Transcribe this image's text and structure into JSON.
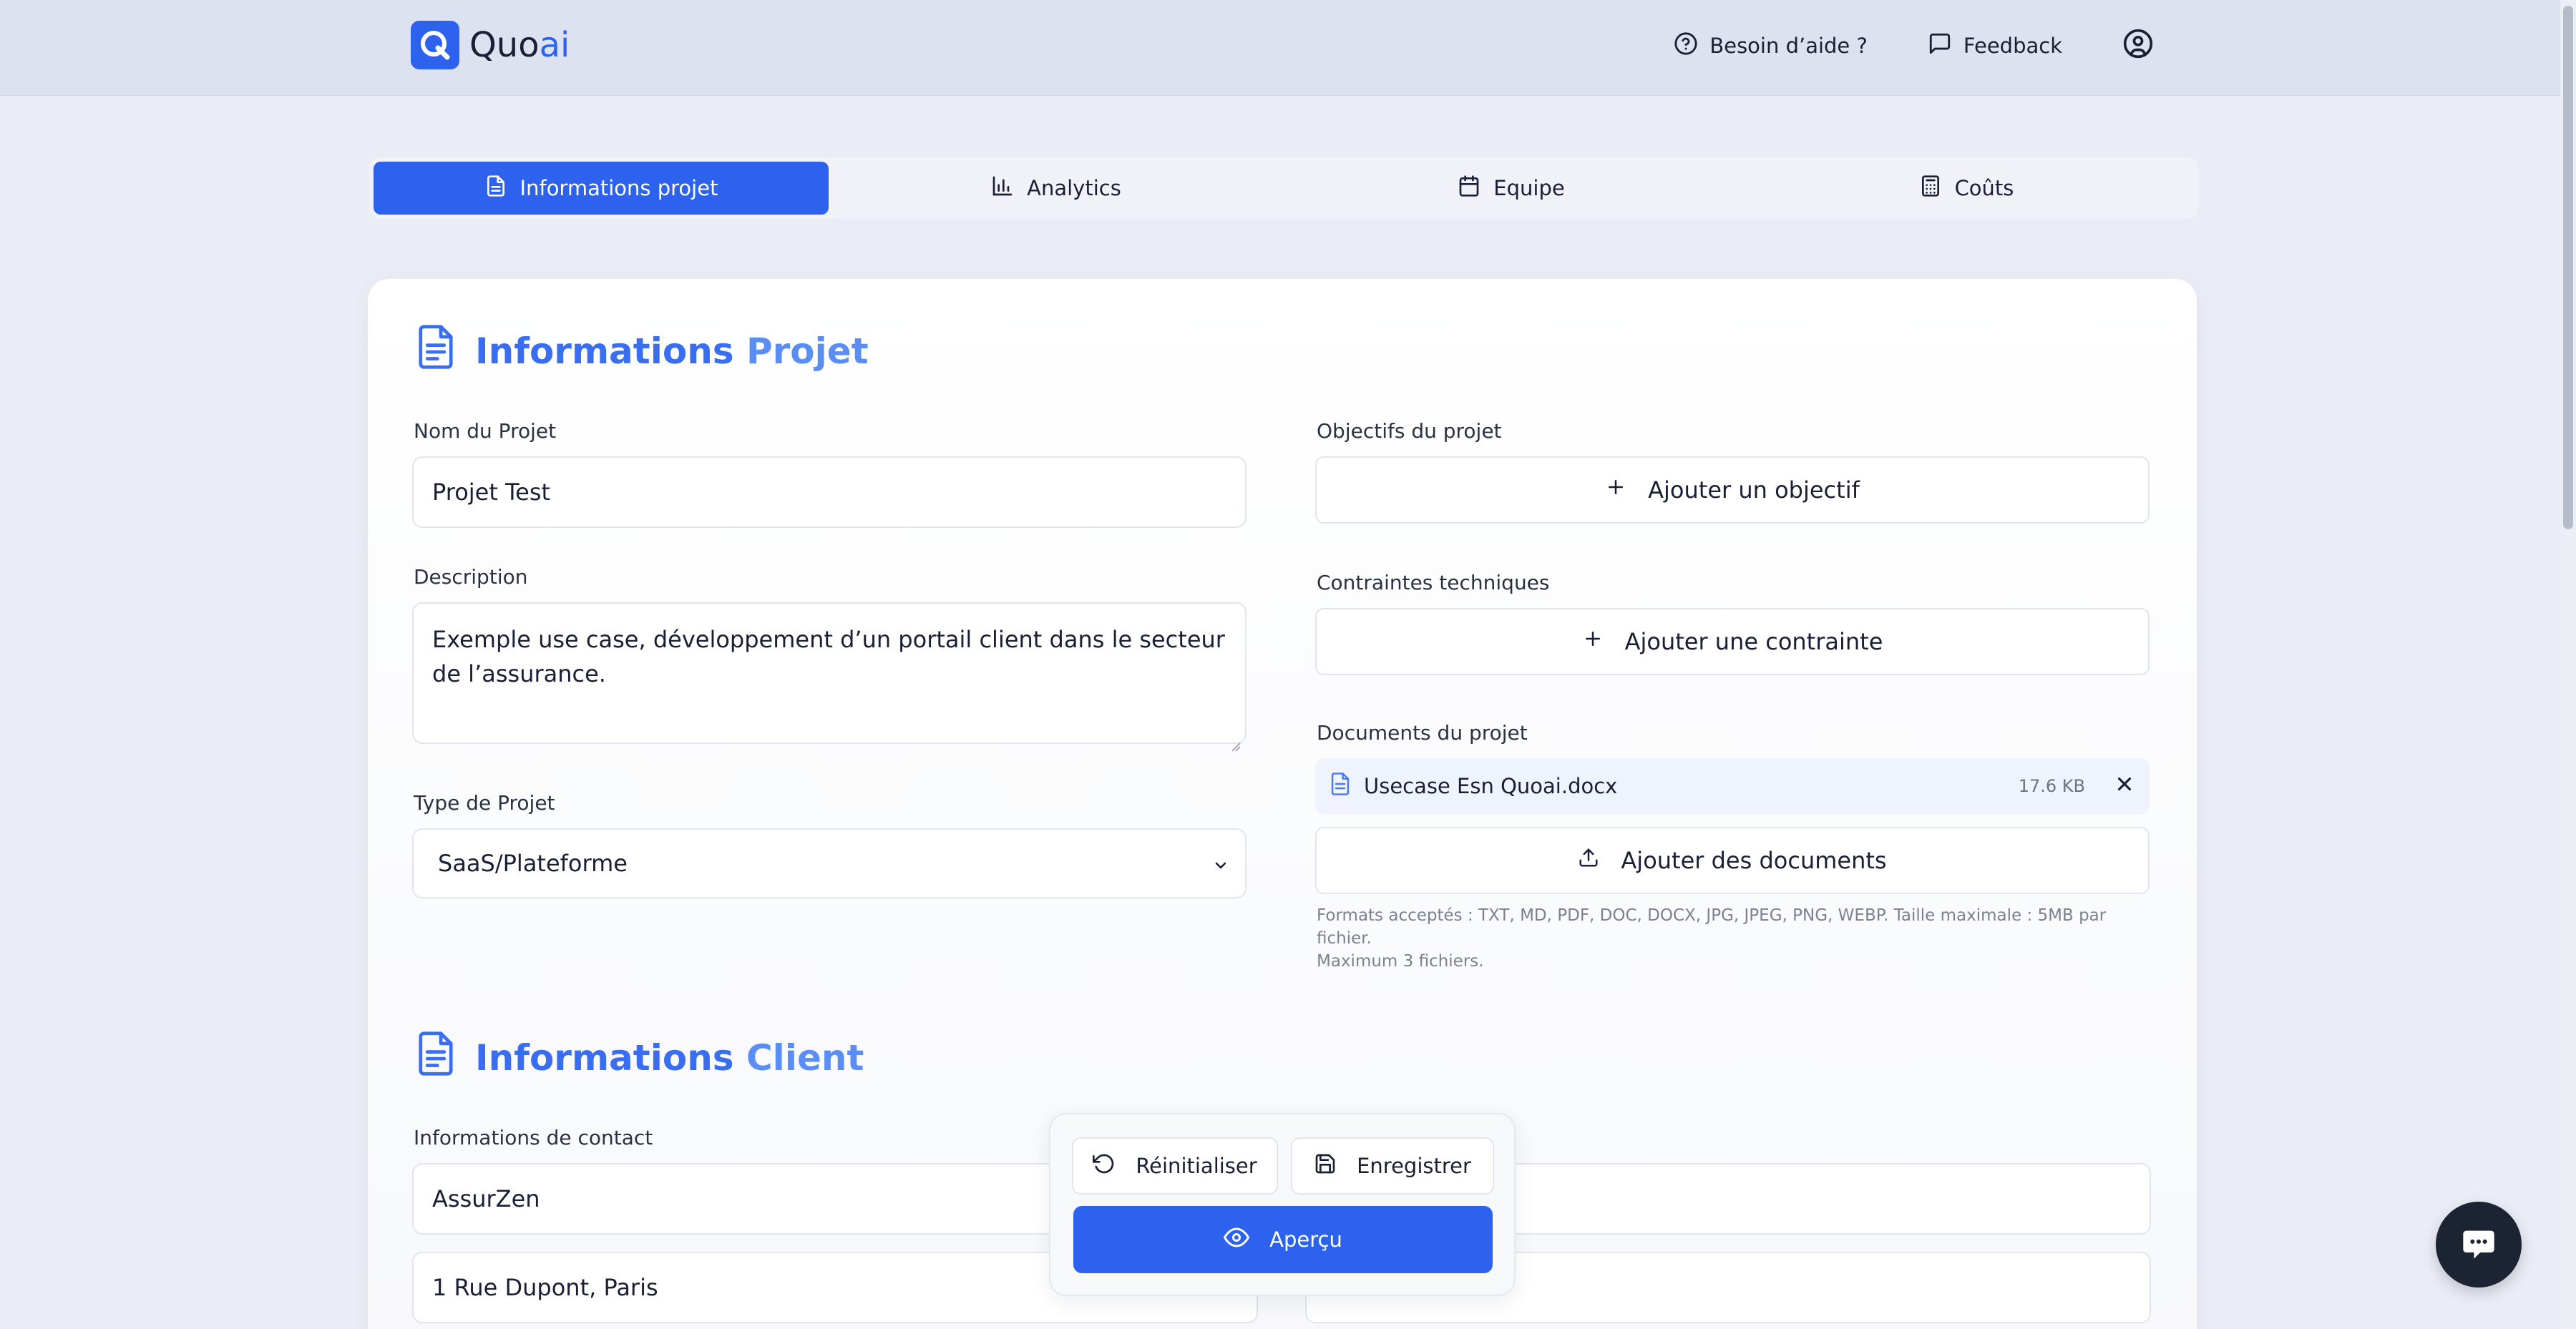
{
  "header": {
    "logo_main": "Quo",
    "logo_accent": "ai",
    "help_label": "Besoin d’aide ?",
    "feedback_label": "Feedback"
  },
  "tabs": [
    {
      "label": "Informations projet",
      "icon": "document-icon",
      "active": true
    },
    {
      "label": "Analytics",
      "icon": "bar-chart-icon",
      "active": false
    },
    {
      "label": "Equipe",
      "icon": "calendar-icon",
      "active": false
    },
    {
      "label": "Coûts",
      "icon": "calculator-icon",
      "active": false
    }
  ],
  "project_section": {
    "title_part1": "Informations",
    "title_part2": "Projet",
    "name_label": "Nom du Projet",
    "name_value": "Projet Test",
    "description_label": "Description",
    "description_value": "Exemple use case, développement d’un portail client dans le secteur de l’assurance.",
    "type_label": "Type de Projet",
    "type_value": "SaaS/Plateforme",
    "objectives_label": "Objectifs du projet",
    "add_objective_label": "Ajouter un objectif",
    "constraints_label": "Contraintes techniques",
    "add_constraint_label": "Ajouter une contrainte",
    "documents_label": "Documents du projet",
    "documents": [
      {
        "name": "Usecase Esn Quoai.docx",
        "size": "17.6 KB"
      }
    ],
    "add_documents_label": "Ajouter des documents",
    "formats_hint_line1": "Formats acceptés : TXT, MD, PDF, DOC, DOCX, JPG, JPEG, PNG, WEBP. Taille maximale : 5MB par fichier.",
    "formats_hint_line2": "Maximum 3 fichiers."
  },
  "client_section": {
    "title_part1": "Informations",
    "title_part2": "Client",
    "contact_label": "Informations de contact",
    "company_value": "AssurZen",
    "address_value": "1 Rue Dupont, Paris"
  },
  "action_panel": {
    "reset_label": "Réinitialiser",
    "save_label": "Enregistrer",
    "preview_label": "Aperçu"
  },
  "colors": {
    "accent": "#2d62ee",
    "title_blue": "#3a6ef0",
    "chat_bg": "#1c2333"
  }
}
